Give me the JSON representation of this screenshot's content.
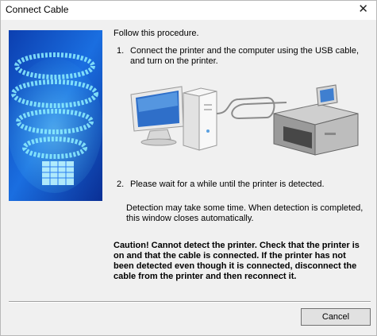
{
  "window": {
    "title": "Connect Cable",
    "close_glyph": "✕"
  },
  "content": {
    "intro": "Follow this procedure.",
    "step1": {
      "number": "1.",
      "text": "Connect the printer and the computer using the USB cable, and turn on the printer."
    },
    "step2": {
      "number": "2.",
      "text": "Please wait for a while until the printer is detected."
    },
    "note": "Detection may take some time. When detection is completed, this window closes automatically.",
    "caution": "Caution! Cannot detect the printer. Check that the printer is on and that the cable is connected. If the printer has not been detected even though it is connected, disconnect the cable from the printer and then reconnect it."
  },
  "illustration": {
    "icons": [
      "monitor-icon",
      "computer-tower-icon",
      "usb-cable-icon",
      "printer-icon"
    ]
  },
  "buttons": {
    "cancel": "Cancel"
  },
  "colors": {
    "side_image_blue": "#1a5fd6",
    "side_image_cyan": "#4fd7ff",
    "button_bg": "#e1e1e1"
  }
}
